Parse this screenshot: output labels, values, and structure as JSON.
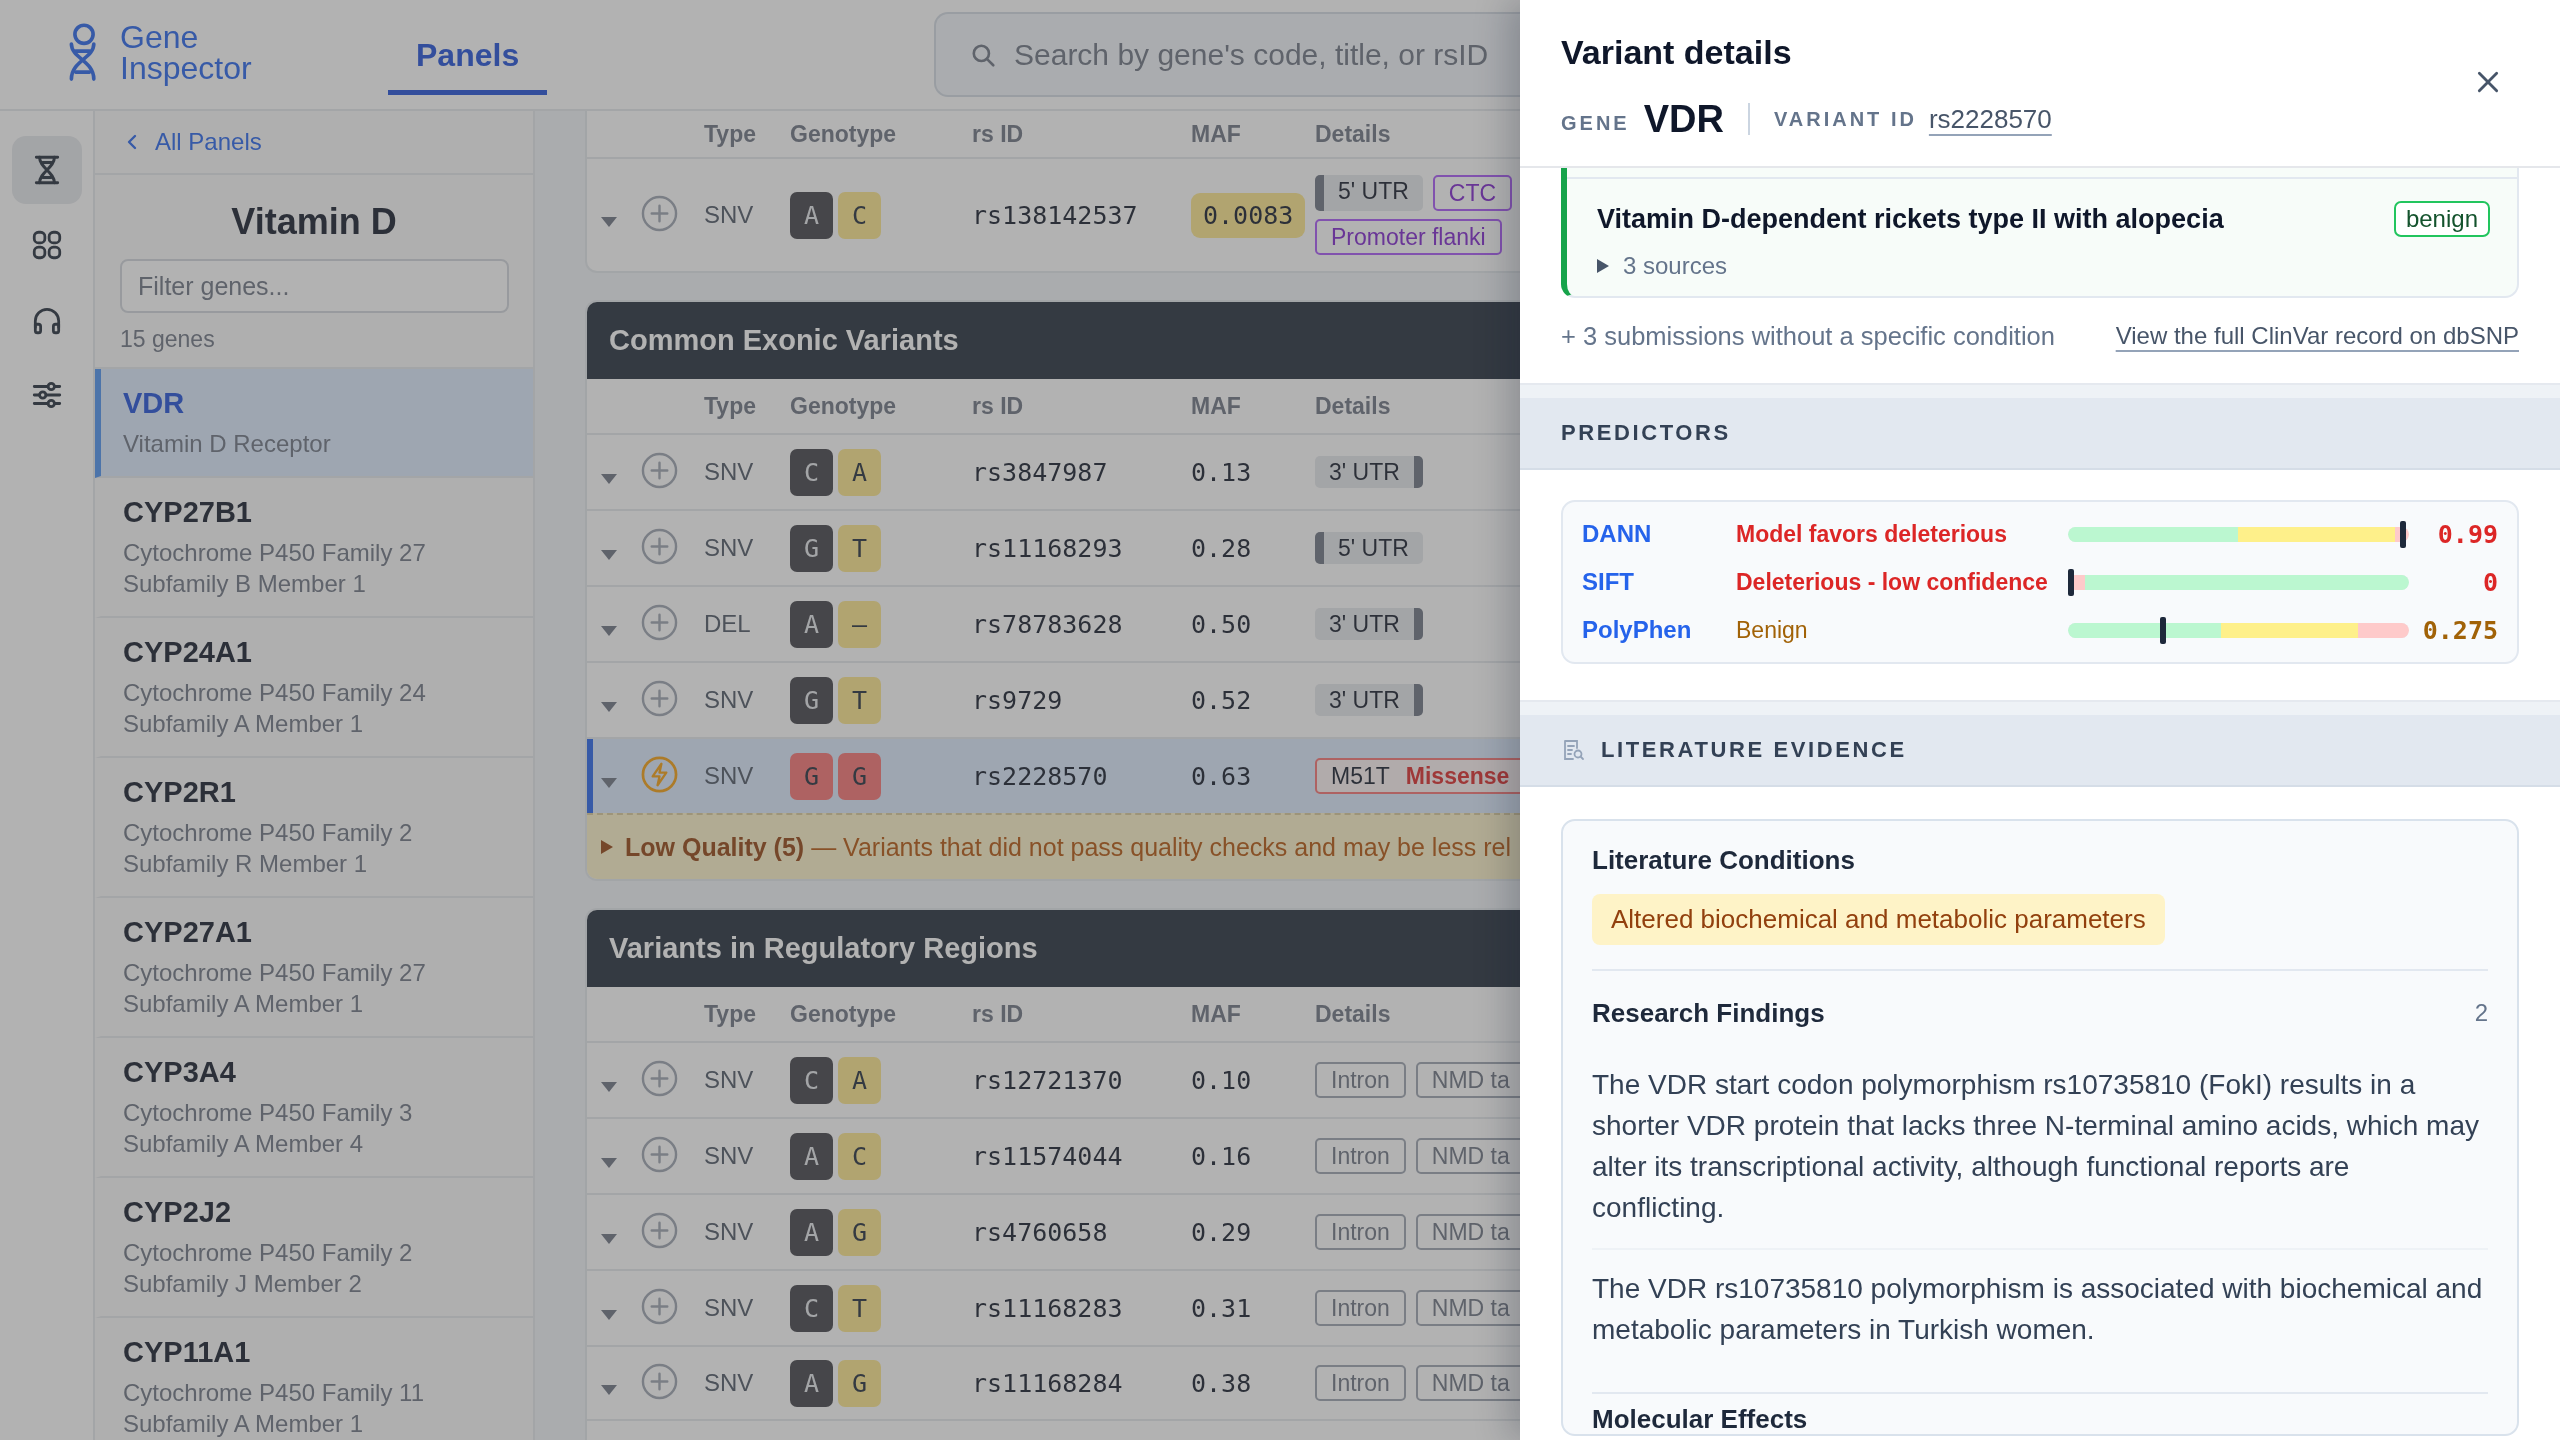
{
  "header": {
    "brand": "Gene Inspector",
    "tabs": [
      {
        "label": "Panels",
        "selected": true
      }
    ],
    "search": {
      "placeholder": "Search by gene's code, title, or rsID"
    }
  },
  "rail": {
    "items": [
      {
        "selected": true
      },
      {
        "selected": false
      },
      {
        "selected": false
      },
      {
        "selected": false
      }
    ]
  },
  "panel": {
    "back_link": "All Panels",
    "title": "Vitamin D",
    "filter": {
      "placeholder": "Filter genes..."
    },
    "count": "15 genes",
    "genes": [
      {
        "symbol": "VDR",
        "name": "Vitamin D Receptor",
        "selected": true
      },
      {
        "symbol": "CYP27B1",
        "name": "Cytochrome P450 Family 27 Subfamily B Member 1",
        "selected": false
      },
      {
        "symbol": "CYP24A1",
        "name": "Cytochrome P450 Family 24 Subfamily A Member 1",
        "selected": false
      },
      {
        "symbol": "CYP2R1",
        "name": "Cytochrome P450 Family 2 Subfamily R Member 1",
        "selected": false
      },
      {
        "symbol": "CYP27A1",
        "name": "Cytochrome P450 Family 27 Subfamily A Member 1",
        "selected": false
      },
      {
        "symbol": "CYP3A4",
        "name": "Cytochrome P450 Family 3 Subfamily A Member 4",
        "selected": false
      },
      {
        "symbol": "CYP2J2",
        "name": "Cytochrome P450 Family 2 Subfamily J Member 2",
        "selected": false
      },
      {
        "symbol": "CYP11A1",
        "name": "Cytochrome P450 Family 11 Subfamily A Member 1",
        "selected": false
      }
    ]
  },
  "variant_groups": [
    {
      "columns": [
        "Type",
        "Genotype",
        "rs ID",
        "MAF",
        "Details"
      ],
      "rows": [
        {
          "type": "SNV",
          "flagged": false,
          "selected": false,
          "genotype": [
            {
              "base": "A",
              "kind": "ref"
            },
            {
              "base": "C",
              "kind": "alt"
            }
          ],
          "rsid": "rs138142537",
          "maf": "0.0083",
          "maf_flagged": true,
          "details": [
            {
              "kind": "utr5",
              "label": "5' UTR"
            },
            {
              "kind": "regulatory",
              "label": "CTC"
            },
            {
              "kind": "regulatory",
              "label": "Promoter flanki"
            }
          ]
        }
      ]
    },
    {
      "title": "Common Exonic Variants",
      "columns": [
        "Type",
        "Genotype",
        "rs ID",
        "MAF",
        "Details"
      ],
      "rows": [
        {
          "type": "SNV",
          "flagged": false,
          "selected": false,
          "genotype": [
            {
              "base": "C",
              "kind": "ref"
            },
            {
              "base": "A",
              "kind": "alt"
            }
          ],
          "rsid": "rs3847987",
          "maf": "0.13",
          "maf_flagged": false,
          "details": [
            {
              "kind": "utr3",
              "label": "3' UTR"
            }
          ]
        },
        {
          "type": "SNV",
          "flagged": false,
          "selected": false,
          "genotype": [
            {
              "base": "G",
              "kind": "ref"
            },
            {
              "base": "T",
              "kind": "alt"
            }
          ],
          "rsid": "rs11168293",
          "maf": "0.28",
          "maf_flagged": false,
          "details": [
            {
              "kind": "utr5",
              "label": "5' UTR"
            }
          ]
        },
        {
          "type": "DEL",
          "flagged": false,
          "selected": false,
          "genotype": [
            {
              "base": "A",
              "kind": "ref"
            },
            {
              "base": "–",
              "kind": "alt"
            }
          ],
          "rsid": "rs78783628",
          "maf": "0.50",
          "maf_flagged": false,
          "details": [
            {
              "kind": "utr3",
              "label": "3' UTR"
            }
          ]
        },
        {
          "type": "SNV",
          "flagged": false,
          "selected": false,
          "genotype": [
            {
              "base": "G",
              "kind": "ref"
            },
            {
              "base": "T",
              "kind": "alt"
            }
          ],
          "rsid": "rs9729",
          "maf": "0.52",
          "maf_flagged": false,
          "details": [
            {
              "kind": "utr3",
              "label": "3' UTR"
            }
          ]
        },
        {
          "type": "SNV",
          "flagged": true,
          "selected": true,
          "genotype": [
            {
              "base": "G",
              "kind": "risk"
            },
            {
              "base": "G",
              "kind": "risk"
            }
          ],
          "rsid": "rs2228570",
          "maf": "0.63",
          "maf_flagged": false,
          "details": [
            {
              "kind": "consequence",
              "change": "M51T",
              "label": "Missense"
            }
          ]
        }
      ],
      "notice": {
        "text": "**Low Quality (5)** — Variants that did not pass quality checks and may be less rel",
        "expanded": false
      }
    },
    {
      "title": "Variants in Regulatory Regions",
      "columns": [
        "Type",
        "Genotype",
        "rs ID",
        "MAF",
        "Details"
      ],
      "rows": [
        {
          "type": "SNV",
          "flagged": false,
          "selected": false,
          "genotype": [
            {
              "base": "C",
              "kind": "ref"
            },
            {
              "base": "A",
              "kind": "alt"
            }
          ],
          "rsid": "rs12721370",
          "maf": "0.10",
          "maf_flagged": false,
          "details": [
            {
              "kind": "feature",
              "label": "Intron"
            },
            {
              "kind": "feature",
              "label": "NMD ta"
            }
          ]
        },
        {
          "type": "SNV",
          "flagged": false,
          "selected": false,
          "genotype": [
            {
              "base": "A",
              "kind": "ref"
            },
            {
              "base": "C",
              "kind": "alt"
            }
          ],
          "rsid": "rs11574044",
          "maf": "0.16",
          "maf_flagged": false,
          "details": [
            {
              "kind": "feature",
              "label": "Intron"
            },
            {
              "kind": "feature",
              "label": "NMD ta"
            }
          ]
        },
        {
          "type": "SNV",
          "flagged": false,
          "selected": false,
          "genotype": [
            {
              "base": "A",
              "kind": "ref"
            },
            {
              "base": "G",
              "kind": "alt"
            }
          ],
          "rsid": "rs4760658",
          "maf": "0.29",
          "maf_flagged": false,
          "details": [
            {
              "kind": "feature",
              "label": "Intron"
            },
            {
              "kind": "feature",
              "label": "NMD ta"
            }
          ]
        },
        {
          "type": "SNV",
          "flagged": false,
          "selected": false,
          "genotype": [
            {
              "base": "C",
              "kind": "ref"
            },
            {
              "base": "T",
              "kind": "alt"
            }
          ],
          "rsid": "rs11168283",
          "maf": "0.31",
          "maf_flagged": false,
          "details": [
            {
              "kind": "feature",
              "label": "Intron"
            },
            {
              "kind": "feature",
              "label": "NMD ta"
            }
          ]
        },
        {
          "type": "SNV",
          "flagged": false,
          "selected": false,
          "genotype": [
            {
              "base": "A",
              "kind": "ref"
            },
            {
              "base": "G",
              "kind": "alt"
            }
          ],
          "rsid": "rs11168284",
          "maf": "0.38",
          "maf_flagged": false,
          "details": [
            {
              "kind": "feature",
              "label": "Intron"
            },
            {
              "kind": "feature",
              "label": "NMD ta"
            }
          ]
        }
      ]
    }
  ],
  "drawer": {
    "title": "Variant details",
    "gene_label": "GENE",
    "gene": "VDR",
    "variant_label": "VARIANT ID",
    "variant_id": "rs2228570",
    "clinvar": {
      "conditions": [
        {
          "title": "Vitamin D-dependent rickets type II with alopecia",
          "significance": "benign",
          "sources": "3 sources",
          "expanded": false
        }
      ],
      "more": "+ 3 submissions without a specific condition",
      "link": "View the full ClinVar record on dbSNP"
    },
    "predictors": {
      "title": "PREDICTORS",
      "items": [
        {
          "name": "DANN",
          "verdict": "Model favors deleterious",
          "severe": true,
          "kind": "rising",
          "level": 0.99,
          "score": "0.99"
        },
        {
          "name": "SIFT",
          "verdict": "Deleterious - low confidence",
          "severe": true,
          "kind": "falling",
          "level": 0,
          "score": "0"
        },
        {
          "name": "PolyPhen",
          "verdict": "Benign",
          "severe": false,
          "kind": "graded",
          "level": 0.275,
          "score": "0.275"
        }
      ]
    },
    "literature": {
      "title": "LITERATURE EVIDENCE",
      "conditions_title": "Literature Conditions",
      "conditions": [
        "Altered biochemical and metabolic parameters"
      ],
      "findings_title": "Research Findings",
      "findings_count": "2",
      "findings": [
        "The VDR start codon polymorphism rs10735810 (FokI) results in a shorter VDR protein that lacks three N-terminal amino acids, which may alter its transcriptional activity, although functional reports are conflicting.",
        "The VDR rs10735810 polymorphism is associated with biochemical and metabolic parameters in Turkish women."
      ],
      "next_title": "Molecular Effects"
    }
  }
}
